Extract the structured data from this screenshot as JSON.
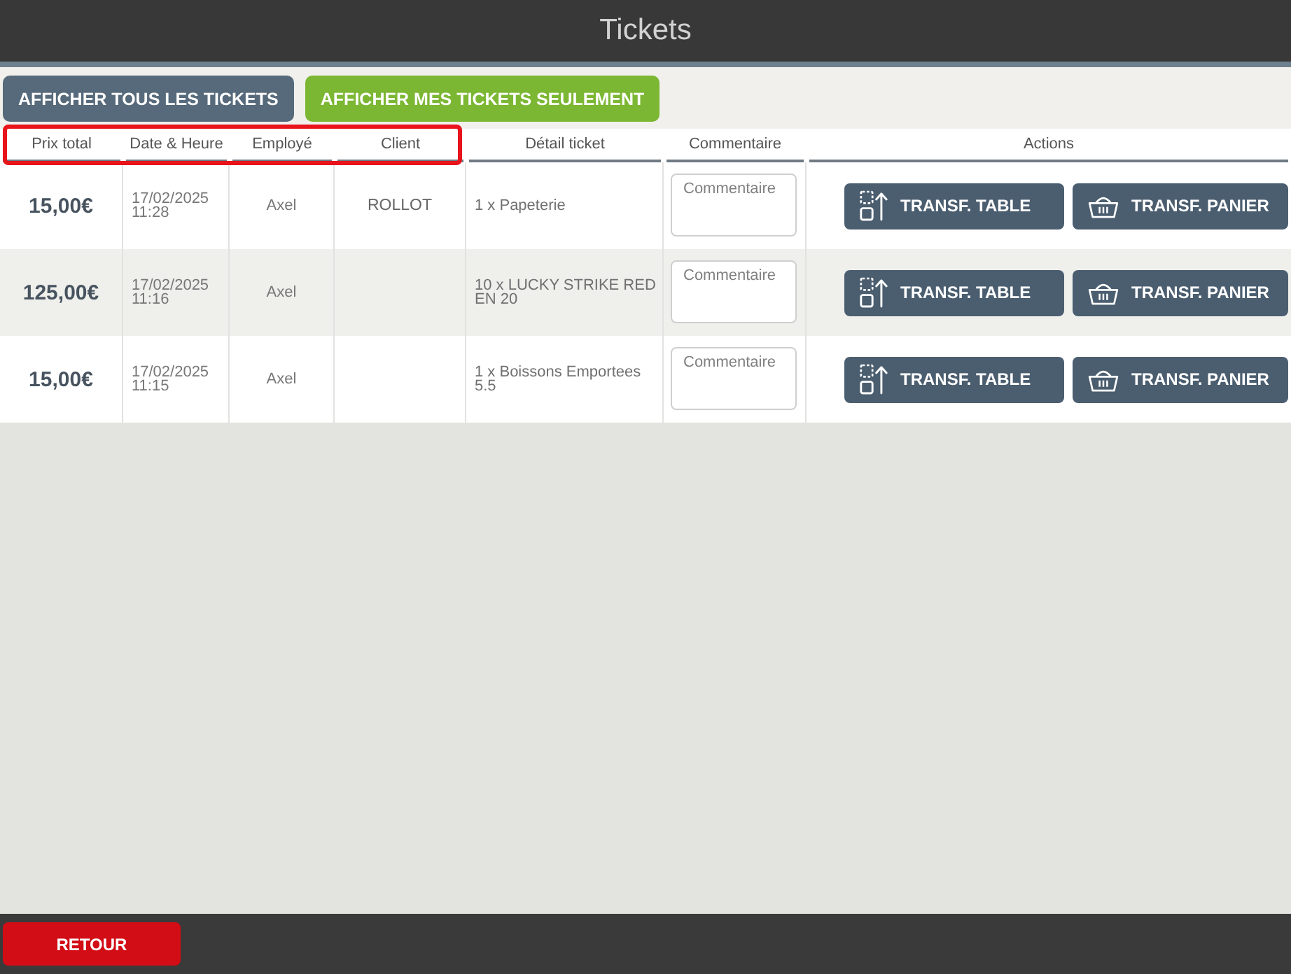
{
  "window": {
    "title": "Tickets"
  },
  "filters": [
    {
      "label": "AFFICHER TOUS LES TICKETS",
      "selected": false
    },
    {
      "label": "AFFICHER MES TICKETS SEULEMENT",
      "selected": true
    }
  ],
  "table": {
    "columns": [
      {
        "label": "Prix total",
        "highlighted": true
      },
      {
        "label": "Date & Heure",
        "highlighted": true
      },
      {
        "label": "Employé",
        "highlighted": true
      },
      {
        "label": "Client",
        "highlighted": true
      },
      {
        "label": "Détail ticket",
        "highlighted": false
      },
      {
        "label": "Commentaire",
        "highlighted": false
      },
      {
        "label": "Actions",
        "highlighted": false
      }
    ],
    "rows": [
      {
        "price": "15,00€",
        "date": "17/02/2025",
        "time": "11:28",
        "employee": "Axel",
        "client": "ROLLOT",
        "detail": "1 x Papeterie",
        "comment": {
          "placeholder": "Commentaire"
        },
        "actions": [
          {
            "kind": "table",
            "label": "TRANSF. TABLE"
          },
          {
            "kind": "basket",
            "label": "TRANSF. PANIER"
          }
        ]
      },
      {
        "price": "125,00€",
        "date": "17/02/2025",
        "time": "11:16",
        "employee": "Axel",
        "detail": "10 x LUCKY STRIKE RED EN 20",
        "comment": {
          "placeholder": "Commentaire"
        },
        "actions": [
          {
            "kind": "table",
            "label": "TRANSF. TABLE"
          },
          {
            "kind": "basket",
            "label": "TRANSF. PANIER"
          }
        ]
      },
      {
        "price": "15,00€",
        "date": "17/02/2025",
        "time": "11:15",
        "employee": "Axel",
        "detail": "1 x Boissons Emportees 5.5",
        "comment": {
          "placeholder": "Commentaire"
        },
        "actions": [
          {
            "kind": "table",
            "label": "TRANSF. TABLE"
          },
          {
            "kind": "basket",
            "label": "TRANSF. PANIER"
          }
        ]
      }
    ]
  },
  "footer": {
    "back_button": "RETOUR"
  }
}
